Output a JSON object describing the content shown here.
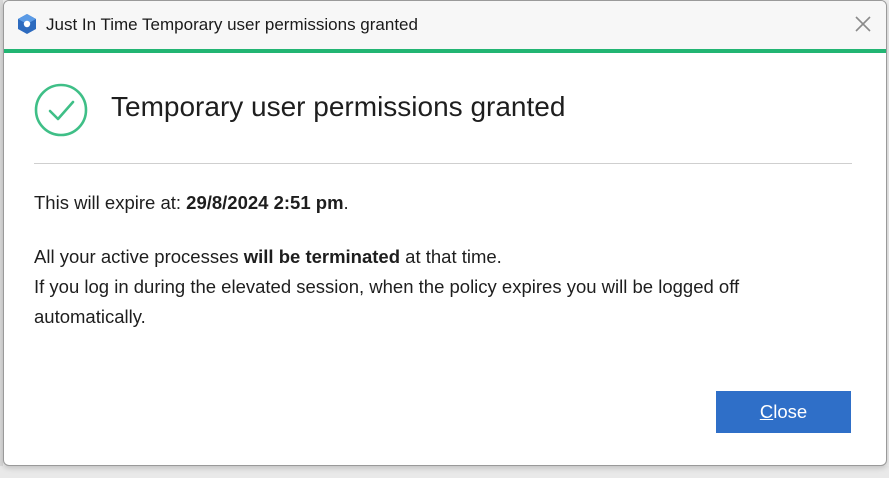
{
  "window": {
    "title": "Just In Time Temporary user permissions granted",
    "accent_color": "#22b573"
  },
  "content": {
    "heading": "Temporary user permissions granted",
    "expire_prefix": "This will expire at: ",
    "expire_value": "29/8/2024 2:51 pm",
    "expire_suffix": ".",
    "procs_prefix": "All your active processes ",
    "procs_bold": "will be terminated",
    "procs_suffix": " at that time.",
    "login_line1": "If you log in during the elevated session, when the policy expires you will be logged off",
    "login_line2": "automatically."
  },
  "buttons": {
    "close_mnemonic": "C",
    "close_rest": "lose",
    "close_color": "#2f6fc8"
  },
  "icons": {
    "app": "app-logo-icon",
    "close": "close-icon",
    "success": "check-circle-icon"
  }
}
